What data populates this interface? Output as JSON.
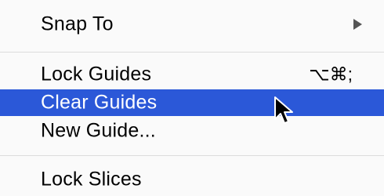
{
  "menu": {
    "items": [
      {
        "label": "Snap To",
        "submenu": true
      },
      {
        "label": "Lock Guides",
        "shortcut": "⌥⌘;"
      },
      {
        "label": "Clear Guides",
        "highlighted": true
      },
      {
        "label": "New Guide..."
      },
      {
        "label": "Lock Slices"
      }
    ]
  },
  "colors": {
    "highlight": "#2b58d8",
    "background": "#fafafa"
  },
  "icons": {
    "cursor": "mouse-pointer-icon",
    "submenu": "triangle-right-icon"
  }
}
